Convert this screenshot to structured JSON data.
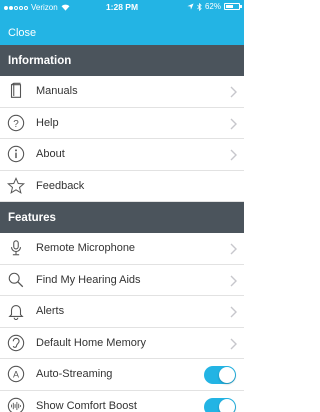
{
  "status_bar": {
    "carrier": "Verizon",
    "time": "1:28 PM",
    "battery": "62%",
    "battery_level": 0.62
  },
  "header": {
    "close_label": "Close"
  },
  "sections": [
    {
      "title": "Information"
    },
    {
      "title": "Features"
    }
  ],
  "information": [
    {
      "label": "Manuals",
      "icon": "book-icon"
    },
    {
      "label": "Help",
      "icon": "question-icon"
    },
    {
      "label": "About",
      "icon": "info-icon"
    },
    {
      "label": "Feedback",
      "icon": "star-icon"
    }
  ],
  "features": [
    {
      "label": "Remote Microphone",
      "icon": "microphone-icon"
    },
    {
      "label": "Find My Hearing Aids",
      "icon": "search-icon"
    },
    {
      "label": "Alerts",
      "icon": "bell-icon"
    },
    {
      "label": "Default Home Memory",
      "icon": "ear-icon"
    },
    {
      "label": "Auto-Streaming",
      "icon": "auto-icon",
      "toggle": true
    },
    {
      "label": "Show Comfort Boost",
      "icon": "wave-icon",
      "toggle": true
    }
  ],
  "colors": {
    "accent": "#23b4e4",
    "section_header": "#4b545c"
  }
}
